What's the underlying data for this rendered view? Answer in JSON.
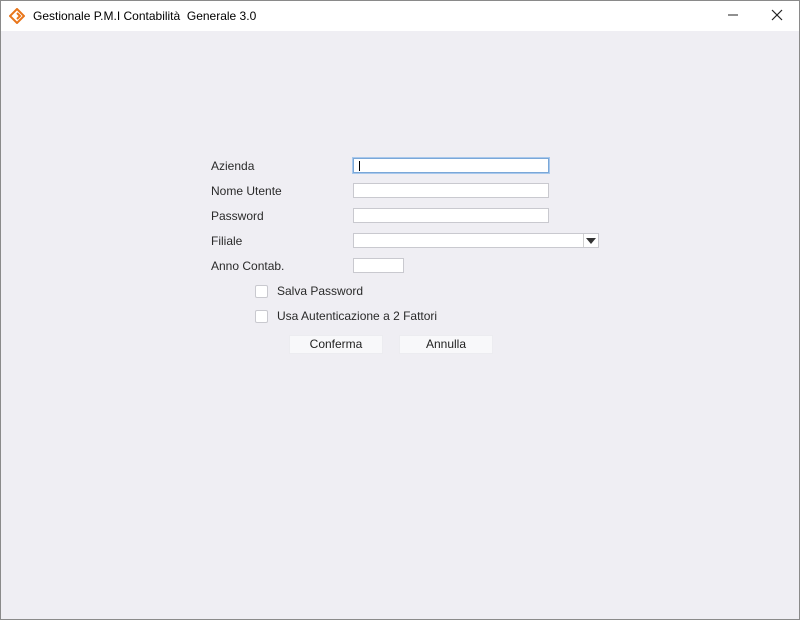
{
  "window": {
    "title": "Gestionale P.M.I Contabilità  Generale 3.0",
    "icons": {
      "app": "app-logo-icon",
      "minimize": "minimize-icon",
      "close": "close-icon"
    },
    "accent_color": "#e8751a"
  },
  "form": {
    "azienda": {
      "label": "Azienda",
      "value": ""
    },
    "nome_utente": {
      "label": "Nome Utente",
      "value": ""
    },
    "password": {
      "label": "Password",
      "value": ""
    },
    "filiale": {
      "label": "Filiale",
      "value": ""
    },
    "anno_contab": {
      "label": "Anno Contab.",
      "value": ""
    },
    "salva_password": {
      "label": "Salva Password",
      "checked": false
    },
    "autenticazione_2fa": {
      "label": "Usa Autenticazione a 2 Fattori",
      "checked": false
    }
  },
  "buttons": {
    "conferma": "Conferma",
    "annulla": "Annulla"
  }
}
